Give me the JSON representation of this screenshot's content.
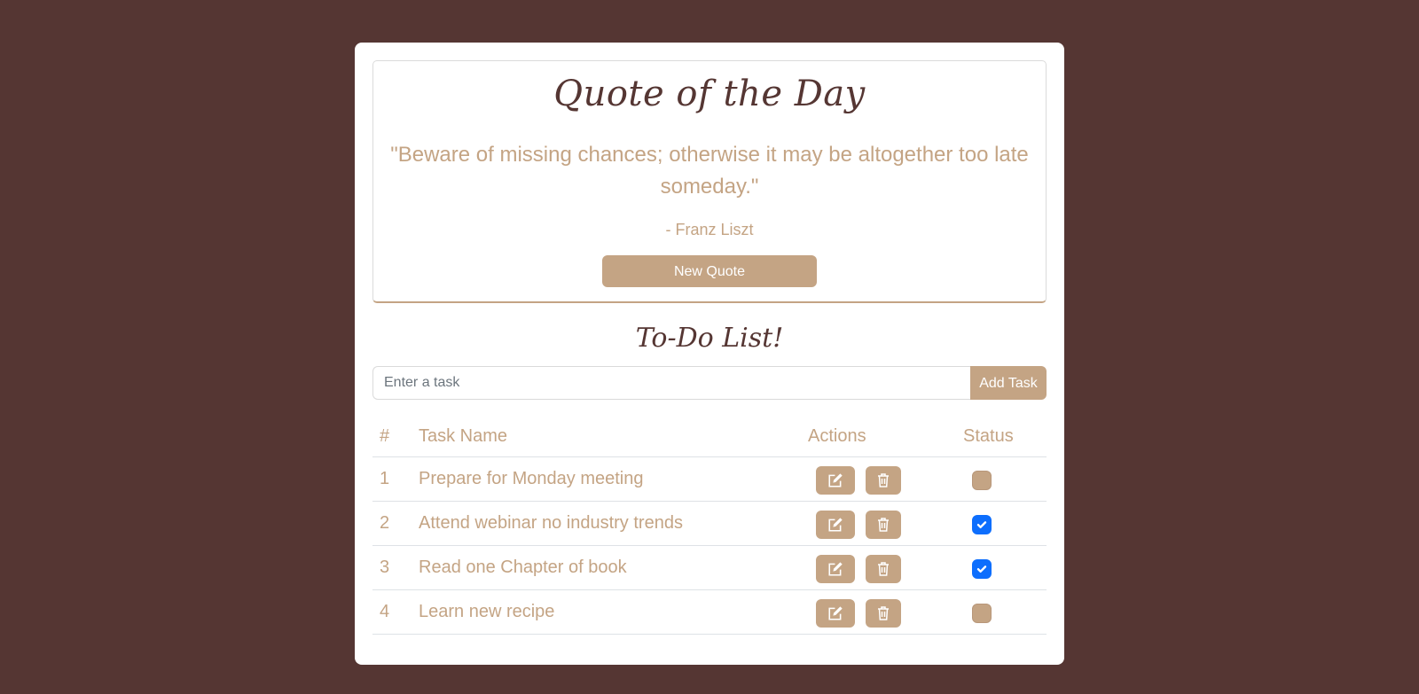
{
  "quote": {
    "title": "Quote of the Day",
    "text": "\"Beware of missing chances; otherwise it may be altogether too late someday.\"",
    "author": "- Franz Liszt",
    "new_quote_label": "New Quote"
  },
  "todo": {
    "title": "To-Do List!",
    "input_placeholder": "Enter a task",
    "add_label": "Add Task",
    "headers": {
      "num": "#",
      "name": "Task Name",
      "actions": "Actions",
      "status": "Status"
    },
    "tasks": [
      {
        "num": "1",
        "name": "Prepare for Monday meeting",
        "done": false
      },
      {
        "num": "2",
        "name": "Attend webinar no industry trends",
        "done": true
      },
      {
        "num": "3",
        "name": "Read one Chapter of book",
        "done": true
      },
      {
        "num": "4",
        "name": "Learn new recipe",
        "done": false
      }
    ]
  },
  "colors": {
    "background": "#553633",
    "accent": "#c4a484",
    "checked": "#0d6efd"
  },
  "icons": {
    "edit": "edit-icon",
    "delete": "trash-icon",
    "check": "check-icon"
  }
}
